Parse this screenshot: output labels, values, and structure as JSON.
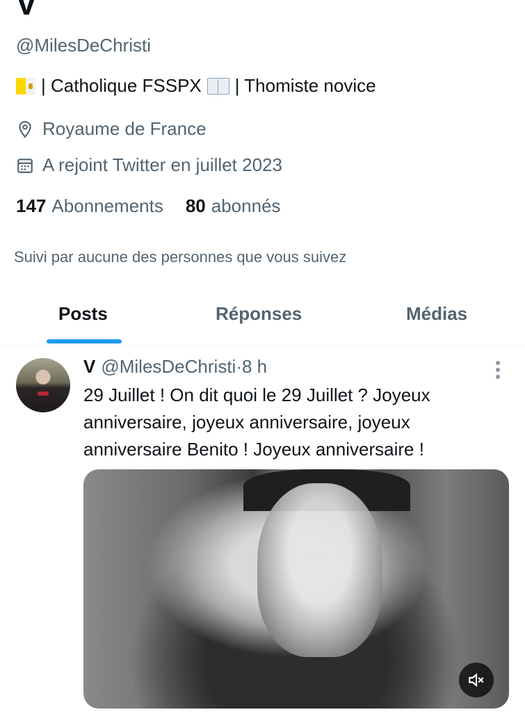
{
  "profile": {
    "name": "V",
    "handle": "@MilesDeChristi",
    "bio": {
      "flag_icon": "vatican-flag-emoji",
      "text_1": " | Catholique FSSPX ",
      "book_icon": "open-book-emoji",
      "text_2": " | Thomiste novice"
    },
    "location": "Royaume de France",
    "joined": "A rejoint Twitter en juillet 2023",
    "following_count": "147",
    "following_label": "Abonnements",
    "followers_count": "80",
    "followers_label": "abonnés",
    "followed_by_note": "Suivi par aucune des personnes que vous suivez"
  },
  "tabs": [
    {
      "label": "Posts",
      "active": true
    },
    {
      "label": "Réponses",
      "active": false
    },
    {
      "label": "Médias",
      "active": false
    }
  ],
  "tweet": {
    "author_name": "V",
    "author_handle": "@MilesDeChristi",
    "separator": " · ",
    "time": "8 h",
    "text": "29 Juillet ! On dit quoi le 29 Juillet ? Joyeux anniversaire, joyeux anniversaire, joyeux anniversaire Benito ! Joyeux anniversaire !",
    "media_type": "video",
    "mute_icon": "volume-muted-icon"
  },
  "colors": {
    "accent": "#1d9bf0",
    "secondary_text": "#536471",
    "primary_text": "#0f1419"
  }
}
